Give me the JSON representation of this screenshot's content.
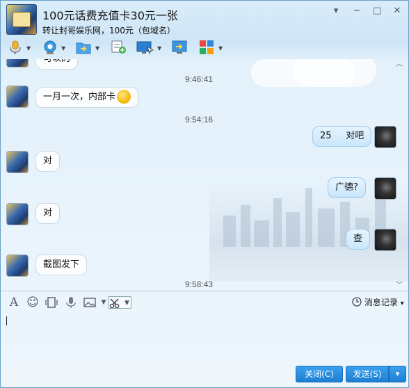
{
  "window": {
    "title": "100元话费充值卡30元一张",
    "subtitle": "转让封哥娱乐网，100元（包域名）",
    "minimize_glyph": "▾",
    "min_glyph": "−",
    "max_glyph": "□",
    "close_glyph": "✕"
  },
  "toolbar": {
    "icons": [
      "microphone-icon",
      "camera-icon",
      "file-transfer-icon",
      "add-note-icon",
      "remote-desktop-icon",
      "screen-share-icon",
      "apps-icon"
    ]
  },
  "messages": {
    "partial_text": "可以的",
    "items": [
      {
        "type": "time",
        "text": "9:46:41"
      },
      {
        "type": "them",
        "text": "一月一次，内部卡"
      },
      {
        "type": "time",
        "text": "9:54:16"
      },
      {
        "type": "me",
        "text": "25     对吧"
      },
      {
        "type": "them",
        "text": "对"
      },
      {
        "type": "me",
        "text": "广德?"
      },
      {
        "type": "them",
        "text": "对"
      },
      {
        "type": "me",
        "text": "查"
      },
      {
        "type": "them",
        "text": "截图发下"
      },
      {
        "type": "time",
        "text": "9:58:43"
      }
    ]
  },
  "input_toolbar": {
    "font_glyph": "A",
    "emoji_glyph": "☺",
    "history_label": "消息记录",
    "history_dropdown": "▾"
  },
  "input": {
    "value": ""
  },
  "footer": {
    "close_label": "关闭(C)",
    "send_label": "发送(S)",
    "send_dropdown": "▾"
  },
  "colors": {
    "accent": "#1d7fd3",
    "window_bg": "#e3f1fb"
  }
}
